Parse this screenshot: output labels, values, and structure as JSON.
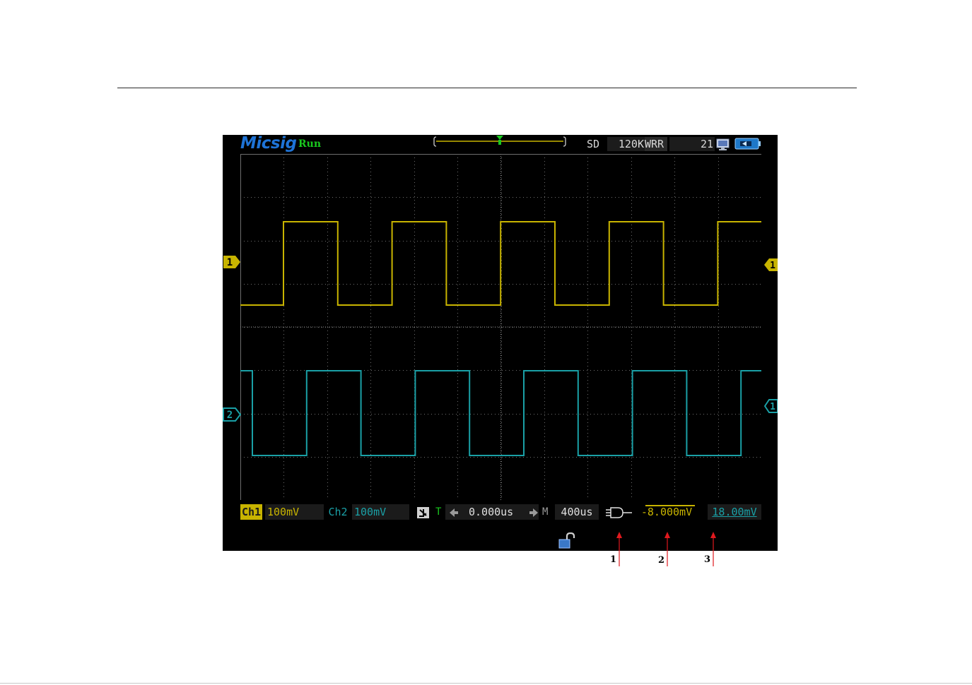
{
  "brand": "Micsig",
  "run_state": "Run",
  "status": {
    "storage": "SD",
    "memory_depth": "120K",
    "acq_mode": "WRR",
    "count": "21"
  },
  "channels": [
    {
      "label": "Ch1",
      "scale": "100mV",
      "marker": "1",
      "color": "#c8b400"
    },
    {
      "label": "Ch2",
      "scale": "100mV",
      "marker": "2",
      "color": "#1aa0a6"
    }
  ],
  "trigger": {
    "marker": "T",
    "label": "T",
    "position": "0.000us",
    "level": "-8.000mV",
    "color": "#19c81e"
  },
  "timebase": {
    "label": "M",
    "scale": "400us"
  },
  "measurement": {
    "value": "18.00mV"
  },
  "right_markers": [
    "1",
    "1"
  ],
  "callouts": [
    "1",
    "2",
    "3"
  ],
  "colors": {
    "callout_arrow": "#e0191e",
    "grid": "#6e6e6e",
    "background": "#000000"
  },
  "icons": [
    "monitor-icon",
    "battery-icon",
    "lock-icon",
    "coupling-icon",
    "trigger-mode-icon"
  ]
}
